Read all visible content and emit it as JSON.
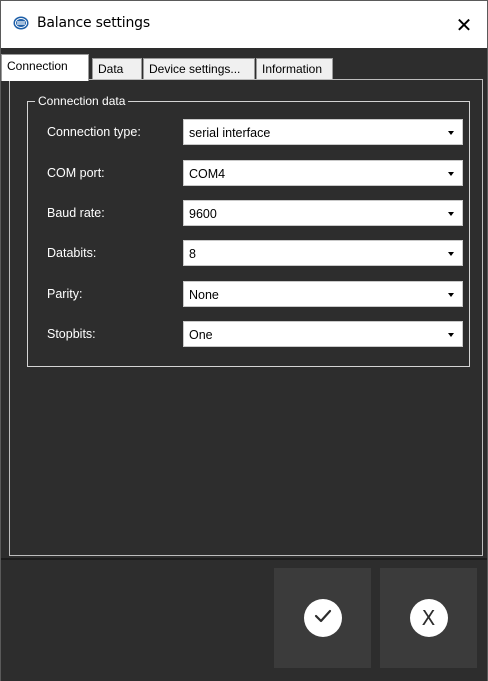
{
  "window": {
    "title": "Balance settings",
    "app_icon": "pce-logo-icon",
    "close_icon": "close-icon",
    "close_glyph": "✕"
  },
  "tabs": [
    {
      "label": "Connection",
      "active": true
    },
    {
      "label": "Data",
      "active": false
    },
    {
      "label": "Device settings...",
      "active": false
    },
    {
      "label": "Information",
      "active": false
    }
  ],
  "group": {
    "legend": "Connection data",
    "rows": [
      {
        "label": "Connection type:",
        "value": "serial interface"
      },
      {
        "label": "COM port:",
        "value": "COM4"
      },
      {
        "label": "Baud rate:",
        "value": "9600"
      },
      {
        "label": "Databits:",
        "value": "8"
      },
      {
        "label": "Parity:",
        "value": "None"
      },
      {
        "label": "Stopbits:",
        "value": "One"
      }
    ]
  },
  "buttons": {
    "ok_icon": "checkmark-icon",
    "cancel_icon": "x-icon",
    "cancel_glyph": "X"
  },
  "colors": {
    "background": "#2d2d2d",
    "button": "#3b3b3b",
    "titlebar": "#ffffff",
    "logo": "#1e5fa8"
  }
}
